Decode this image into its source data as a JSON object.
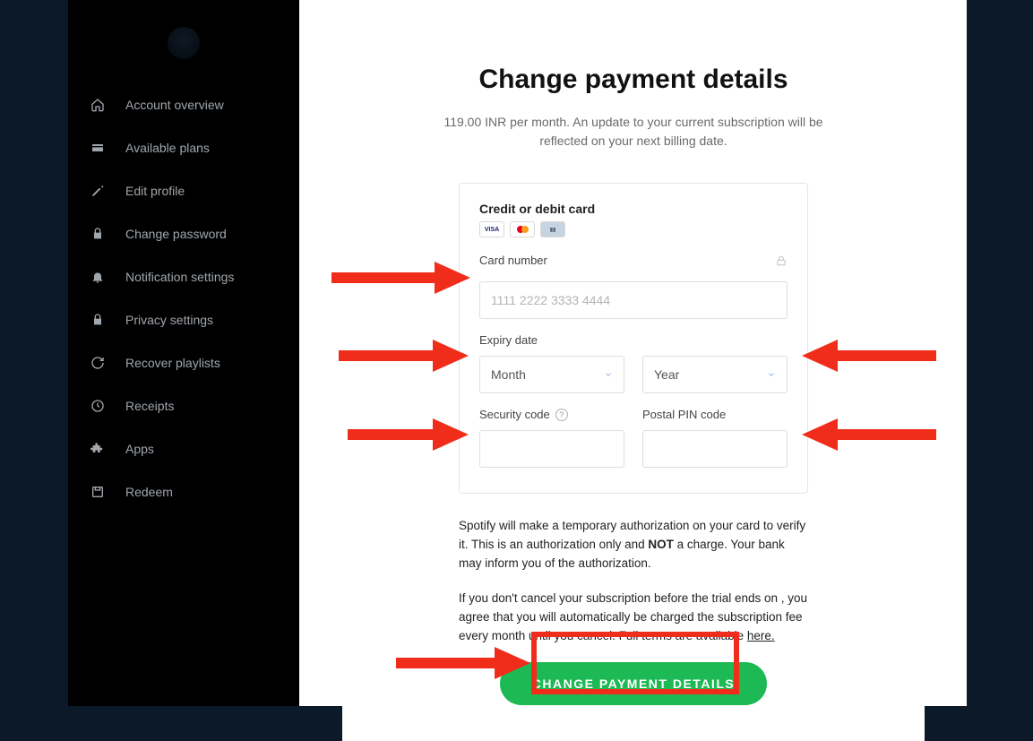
{
  "sidebar": {
    "items": [
      {
        "icon": "home-icon",
        "label": "Account overview"
      },
      {
        "icon": "card-icon",
        "label": "Available plans"
      },
      {
        "icon": "pencil-icon",
        "label": "Edit profile"
      },
      {
        "icon": "lock-icon",
        "label": "Change password"
      },
      {
        "icon": "bell-icon",
        "label": "Notification settings"
      },
      {
        "icon": "lock-icon",
        "label": "Privacy settings"
      },
      {
        "icon": "refresh-icon",
        "label": "Recover playlists"
      },
      {
        "icon": "clock-icon",
        "label": "Receipts"
      },
      {
        "icon": "puzzle-icon",
        "label": "Apps"
      },
      {
        "icon": "save-icon",
        "label": "Redeem"
      }
    ]
  },
  "page": {
    "title": "Change payment details",
    "subtitle": "119.00 INR per month. An update to your current subscription will be reflected on your next billing date."
  },
  "form": {
    "section_label": "Credit or debit card",
    "card_number_label": "Card number",
    "card_number_placeholder": "1111 2222 3333 4444",
    "expiry_label": "Expiry date",
    "month_placeholder": "Month",
    "year_placeholder": "Year",
    "security_label": "Security code",
    "postal_label": "Postal PIN code"
  },
  "disclaimer": {
    "p1_a": "Spotify will make a temporary authorization on your card to verify it. This is an authorization only and ",
    "p1_b": "NOT",
    "p1_c": " a charge. Your bank may inform you of the authorization.",
    "p2_a": "If you don't cancel your subscription before the trial ends on , you agree that you will automatically be charged the subscription fee every month until you cancel. Full terms are available ",
    "p2_link": "here."
  },
  "submit": {
    "label": "CHANGE PAYMENT DETAILS"
  },
  "annotation": {
    "color": "#ef2d1a"
  }
}
